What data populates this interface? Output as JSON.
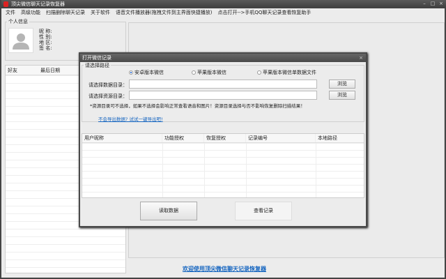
{
  "window": {
    "title": "顶尖微信聊天记录恢复器",
    "controls": [
      "–",
      "□",
      "×"
    ]
  },
  "menu": [
    "文件",
    "高级功能",
    "扫描删除聊天记录",
    "关于软件",
    "语音文件播放器(拖拽文件到主界面快捷播放)",
    "点击打开-->手机QQ聊天记录查看恢复助手"
  ],
  "profile": {
    "group_label": "个人信息",
    "fields": [
      "昵 称:",
      "性 别:",
      "地 区:",
      "签 名:"
    ]
  },
  "friends": {
    "columns": [
      "好友",
      "最后日期"
    ]
  },
  "welcome_link": "欢迎使用顶尖微信聊天记录恢复器",
  "dialog": {
    "title": "打开微信记录",
    "close": "×",
    "path_group": "请选择路径",
    "radios": [
      {
        "label": "安卓版本微信",
        "checked": true
      },
      {
        "label": "苹果版本微信",
        "checked": false
      },
      {
        "label": "苹果版本微信单数据文件",
        "checked": false
      }
    ],
    "data_dir_label": "请选择数据目录：",
    "data_dir_value": "",
    "res_dir_label": "请选择资源目录：",
    "res_dir_value": "",
    "browse": "浏览",
    "note": "*资源目录可不选择，如果不选择会影响正常查看语音和图片！资源目录选择与否不影响恢复删除扫描结果！",
    "help_link": "不会导出数据? 试试一键导出吧!",
    "columns": [
      "用户昵称",
      "功能授权",
      "恢复授权",
      "记录编号",
      "本地路径"
    ],
    "read_button": "读取数据",
    "view_button": "查看记录"
  }
}
